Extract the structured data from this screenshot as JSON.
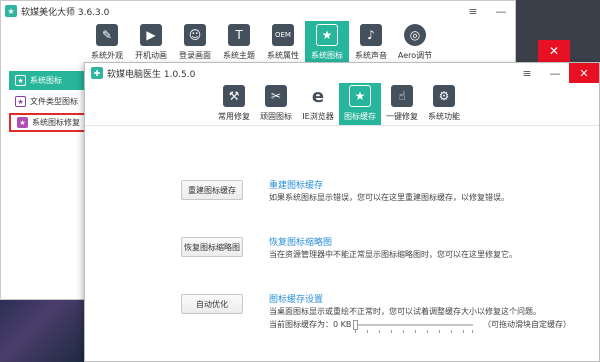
{
  "back_window": {
    "title": "软媒美化大师 3.6.3.0",
    "nav": [
      {
        "label": "系统外观",
        "icon": "brush-icon"
      },
      {
        "label": "开机动画",
        "icon": "play-icon"
      },
      {
        "label": "登录画面",
        "icon": "user-icon"
      },
      {
        "label": "系统主题",
        "icon": "tshirt-icon"
      },
      {
        "label": "系统属性",
        "icon": "oem-icon"
      },
      {
        "label": "系统图标",
        "icon": "star-icon",
        "active": true
      },
      {
        "label": "系统声音",
        "icon": "speaker-icon"
      },
      {
        "label": "Aero调节",
        "icon": "aero-icon"
      }
    ],
    "sidebar": [
      {
        "label": "系统图标",
        "active": true
      },
      {
        "label": "文件类型图标"
      },
      {
        "label": "系统图标修复",
        "outlined": true
      }
    ]
  },
  "front_window": {
    "title": "软媒电脑医生 1.0.5.0",
    "toolbar": [
      {
        "label": "常用修复",
        "icon": "repair-icon"
      },
      {
        "label": "顽固图标",
        "icon": "tools-icon"
      },
      {
        "label": "IE浏览器",
        "icon": "ie-icon"
      },
      {
        "label": "图标缓存",
        "icon": "star-icon",
        "active": true
      },
      {
        "label": "一键修复",
        "icon": "hand-click-icon"
      },
      {
        "label": "系统功能",
        "icon": "gears-icon"
      }
    ],
    "rows": [
      {
        "button": "重建图标缓存",
        "title": "重建图标缓存",
        "desc": "如果系统图标显示错误，您可以在这里重建图标缓存，以修复错误。"
      },
      {
        "button": "恢复图标缩略图",
        "title": "恢复图标缩略图",
        "desc": "当在资源管理器中不能正常显示图标缩略图时，您可以在这里修复它。"
      },
      {
        "button": "自动优化",
        "title": "图标缓存设置",
        "desc": "当桌面图标显示或重绘不正常时，您可以试着调整缓存大小以修复这个问题。"
      }
    ],
    "cache_label": "当前图标缓存为：0 KB",
    "cache_value_kb": 0,
    "cache_hint": "（可拖动滑块自定缓存）"
  },
  "colors": {
    "accent": "#27b59c",
    "link": "#2a8fd6",
    "close": "#e81123",
    "highlight": "#e02b2b"
  }
}
